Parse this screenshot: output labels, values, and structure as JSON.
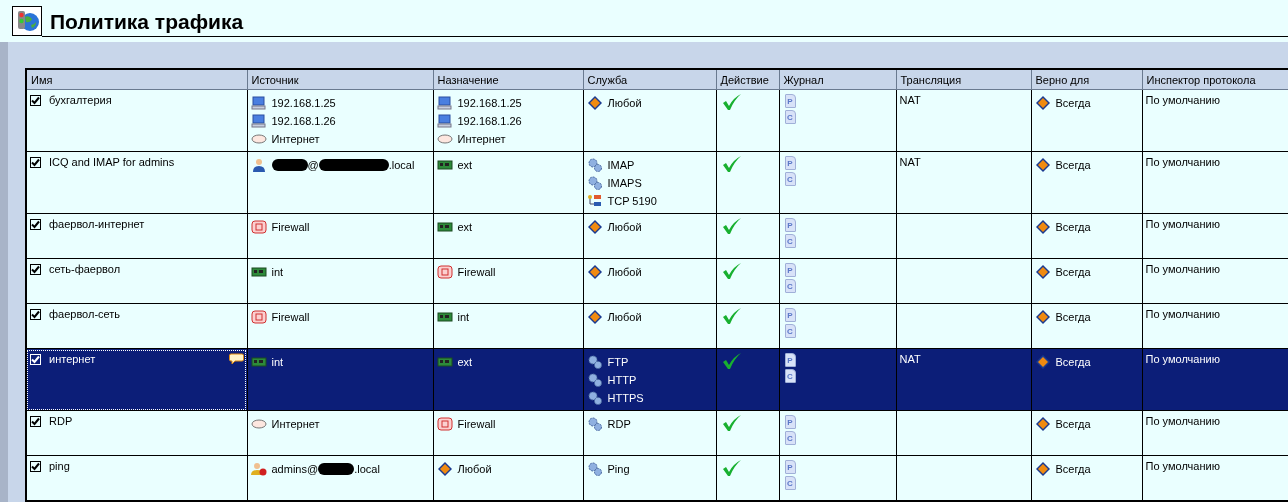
{
  "title": "Политика трафика",
  "table": {
    "columns": [
      "Имя",
      "Источник",
      "Назначение",
      "Служба",
      "Действие",
      "Журнал",
      "Трансляция",
      "Верно для",
      "Инспектор протокола"
    ],
    "rows": [
      {
        "name": "бухгалтерия",
        "enabled": true,
        "selected": false,
        "comment": false,
        "source": [
          {
            "kind": "host",
            "text": "192.168.1.25"
          },
          {
            "kind": "host",
            "text": "192.168.1.26"
          },
          {
            "kind": "internet",
            "text": "Интернет"
          }
        ],
        "destination": [
          {
            "kind": "host",
            "text": "192.168.1.25"
          },
          {
            "kind": "host",
            "text": "192.168.1.26"
          },
          {
            "kind": "internet",
            "text": "Интернет"
          }
        ],
        "service": [
          {
            "kind": "any",
            "text": "Любой"
          }
        ],
        "allowed": true,
        "journal": [
          "P",
          "C"
        ],
        "translation": "NAT",
        "valid_for": "Всегда",
        "inspector": "По умолчанию"
      },
      {
        "name": "ICQ and IMAP for admins",
        "enabled": true,
        "selected": false,
        "comment": false,
        "source": [
          {
            "kind": "user",
            "segments": [
              {
                "kind": "redacted"
              },
              {
                "kind": "text",
                "text": "@"
              },
              {
                "kind": "redacted"
              },
              {
                "kind": "text",
                "text": ".local"
              }
            ]
          }
        ],
        "destination": [
          {
            "kind": "nic",
            "text": "ext"
          }
        ],
        "service": [
          {
            "kind": "gears",
            "text": "IMAP"
          },
          {
            "kind": "gears",
            "text": "IMAPS"
          },
          {
            "kind": "tcp",
            "text": "TCP 5190"
          }
        ],
        "allowed": true,
        "journal": [
          "P",
          "C"
        ],
        "translation": "NAT",
        "valid_for": "Всегда",
        "inspector": "По умолчанию"
      },
      {
        "name": "фаервол-интернет",
        "enabled": true,
        "selected": false,
        "comment": false,
        "source": [
          {
            "kind": "firewall",
            "text": "Firewall"
          }
        ],
        "destination": [
          {
            "kind": "nic",
            "text": "ext"
          }
        ],
        "service": [
          {
            "kind": "any",
            "text": "Любой"
          }
        ],
        "allowed": true,
        "journal": [
          "P",
          "C"
        ],
        "valid_for": "Всегда",
        "inspector": "По умолчанию"
      },
      {
        "name": "сеть-фаервол",
        "enabled": true,
        "selected": false,
        "comment": false,
        "source": [
          {
            "kind": "nic",
            "text": "int"
          }
        ],
        "destination": [
          {
            "kind": "firewall",
            "text": "Firewall"
          }
        ],
        "service": [
          {
            "kind": "any",
            "text": "Любой"
          }
        ],
        "allowed": true,
        "journal": [
          "P",
          "C"
        ],
        "valid_for": "Всегда",
        "inspector": "По умолчанию"
      },
      {
        "name": "фаервол-сеть",
        "enabled": true,
        "selected": false,
        "comment": false,
        "source": [
          {
            "kind": "firewall",
            "text": "Firewall"
          }
        ],
        "destination": [
          {
            "kind": "nic",
            "text": "int"
          }
        ],
        "service": [
          {
            "kind": "any",
            "text": "Любой"
          }
        ],
        "allowed": true,
        "journal": [
          "P",
          "C"
        ],
        "valid_for": "Всегда",
        "inspector": "По умолчанию"
      },
      {
        "name": "интернет",
        "enabled": true,
        "selected": true,
        "comment": true,
        "source": [
          {
            "kind": "nic",
            "text": "int"
          }
        ],
        "destination": [
          {
            "kind": "nic",
            "text": "ext"
          }
        ],
        "service": [
          {
            "kind": "gears",
            "text": "FTP"
          },
          {
            "kind": "gears",
            "text": "HTTP"
          },
          {
            "kind": "gears",
            "text": "HTTPS"
          }
        ],
        "allowed": true,
        "journal": [
          "P",
          "C"
        ],
        "translation": "NAT",
        "valid_for": "Всегда",
        "inspector": "По умолчанию"
      },
      {
        "name": "RDP",
        "enabled": true,
        "selected": false,
        "comment": false,
        "source": [
          {
            "kind": "internet",
            "text": "Интернет"
          }
        ],
        "destination": [
          {
            "kind": "firewall",
            "text": "Firewall"
          }
        ],
        "service": [
          {
            "kind": "gears",
            "text": "RDP"
          }
        ],
        "allowed": true,
        "journal": [
          "P",
          "C"
        ],
        "valid_for": "Всегда",
        "inspector": "По умолчанию"
      },
      {
        "name": "ping",
        "enabled": true,
        "selected": false,
        "comment": false,
        "source": [
          {
            "kind": "users",
            "segments": [
              {
                "kind": "text",
                "text": "admins@"
              },
              {
                "kind": "redacted"
              },
              {
                "kind": "text",
                "text": ".local"
              }
            ]
          }
        ],
        "destination": [
          {
            "kind": "any",
            "text": "Любой"
          }
        ],
        "service": [
          {
            "kind": "gears",
            "text": "Ping"
          }
        ],
        "allowed": true,
        "journal": [
          "P",
          "C"
        ],
        "valid_for": "Всегда",
        "inspector": "По умолчанию"
      }
    ]
  }
}
